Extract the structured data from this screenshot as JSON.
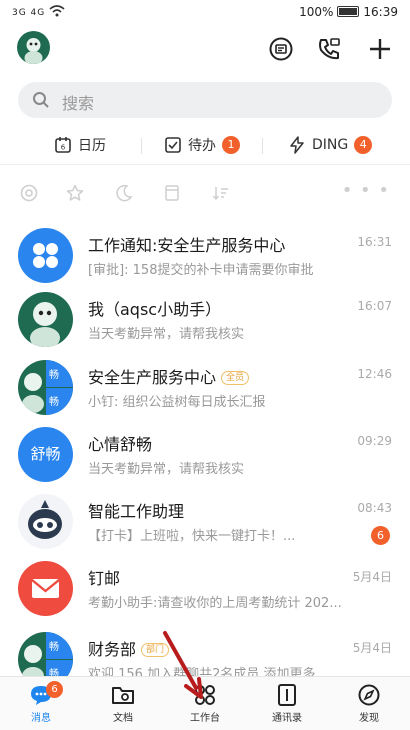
{
  "status": {
    "signal": "3G 4G",
    "battery": "100%",
    "time": "16:39"
  },
  "search": {
    "placeholder": "搜索"
  },
  "quick": [
    {
      "label": "日历",
      "badge": ""
    },
    {
      "label": "待办",
      "badge": "1"
    },
    {
      "label": "DING",
      "badge": "4"
    }
  ],
  "chats": [
    {
      "title": "工作通知:安全生产服务中心",
      "tag": "",
      "sub": "[审批]: 158提交的补卡申请需要你审批",
      "time": "16:31",
      "badge": "",
      "avatar_text": ""
    },
    {
      "title": "我（aqsc小助手）",
      "tag": "",
      "sub": "当天考勤异常，请帮我核实",
      "time": "16:07",
      "badge": "",
      "avatar_text": ""
    },
    {
      "title": "安全生产服务中心",
      "tag": "全员",
      "sub": "小钉: 组织公益树每日成长汇报",
      "time": "12:46",
      "badge": "",
      "avatar_text": "畅"
    },
    {
      "title": "心情舒畅",
      "tag": "",
      "sub": "当天考勤异常，请帮我核实",
      "time": "09:29",
      "badge": "",
      "avatar_text": "舒畅"
    },
    {
      "title": "智能工作助理",
      "tag": "",
      "sub": "【打卡】上班啦，快来一键打卡！...",
      "time": "08:43",
      "badge": "6",
      "avatar_text": ""
    },
    {
      "title": "钉邮",
      "tag": "",
      "sub": "考勤小助手:请查收你的上周考勤统计 202...",
      "time": "5月4日",
      "badge": "",
      "avatar_text": ""
    },
    {
      "title": "财务部",
      "tag": "部门",
      "sub": "欢迎 156 加入群聊共2名成员 添加更多",
      "time": "5月4日",
      "badge": "",
      "avatar_text": "畅"
    }
  ],
  "tabs": [
    {
      "label": "消息",
      "badge": "6"
    },
    {
      "label": "文档",
      "badge": ""
    },
    {
      "label": "工作台",
      "badge": ""
    },
    {
      "label": "通讯录",
      "badge": ""
    },
    {
      "label": "发现",
      "badge": ""
    }
  ],
  "colors": {
    "accent": "#1f86ee",
    "badge": "#f2612c",
    "arrow": "#b81c1c"
  }
}
